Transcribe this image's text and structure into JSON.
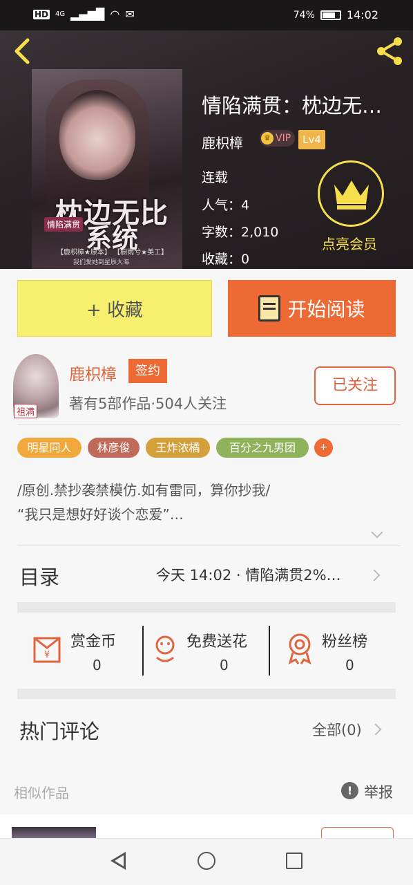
{
  "status_bar": {
    "network": "HD",
    "signal": "4G",
    "battery": "74%",
    "battery_level": 0.74,
    "time": "14:02"
  },
  "header": {
    "back_icon": "chevron-left-icon",
    "share_icon": "share-icon",
    "cover": {
      "title_line1": "枕边无比",
      "title_line2": "系统",
      "badge": "情陷满贯",
      "credit": "【鹿枳樟★原本】 【橱雨兮★美工】",
      "slogan": "我们爱她到星辰大海"
    },
    "book_title": "情陷满贯：枕边无…",
    "author": "鹿枳樟",
    "vip_label": "VIP",
    "level": "Lv4",
    "status": "连载",
    "popularity": "人气：4",
    "word_count": "字数：2,010",
    "favorites": "收藏：0",
    "member_label": "点亮会员"
  },
  "actions": {
    "collect": "+ 收藏",
    "read": "开始阅读"
  },
  "author_row": {
    "avatar_tag": "祖满",
    "name": "鹿枳樟",
    "signed_badge": "签约",
    "info": "著有5部作品·504人关注",
    "follow": "已关注"
  },
  "tags": [
    {
      "label": "明星同人",
      "color": "#f2a93b"
    },
    {
      "label": "林彦俊",
      "color": "#c06b5a"
    },
    {
      "label": "王炸浓橘",
      "color": "#d4a03c"
    },
    {
      "label": "百分之九男团",
      "color": "#8fb35a"
    }
  ],
  "tag_more": "+",
  "description": {
    "line1": "/原创.禁抄袭禁模仿.如有雷同，算你抄我/",
    "line2": "“我只是想好好谈个恋爱”…"
  },
  "catalog": {
    "title": "目录",
    "latest": "今天 14:02 · 情陷满贯2%…"
  },
  "stats": [
    {
      "icon": "red-envelope-icon",
      "label": "赏金币",
      "value": "0"
    },
    {
      "icon": "flower-icon",
      "label": "免费送花",
      "value": "0"
    },
    {
      "icon": "medal-icon",
      "label": "粉丝榜",
      "value": "0"
    }
  ],
  "comments": {
    "title": "热门评论",
    "all": "全部(0)"
  },
  "similar": {
    "title": "相似作品",
    "report": "举报"
  }
}
